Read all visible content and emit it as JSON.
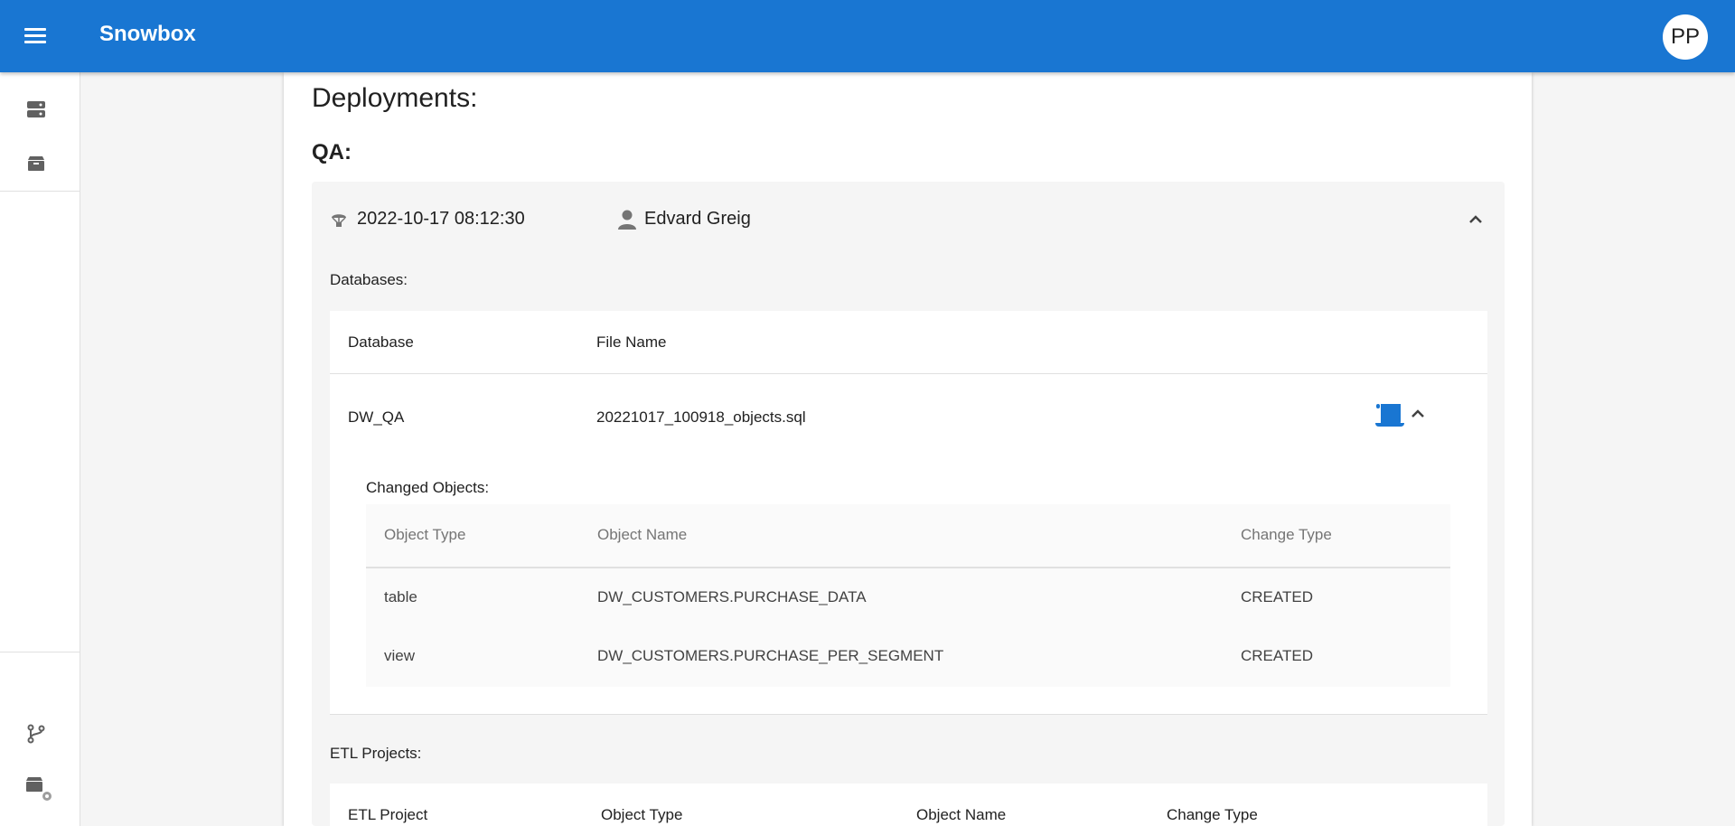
{
  "app": {
    "title": "Snowbox",
    "avatar_initials": "PP",
    "brand_color": "#1976d2"
  },
  "sidebar": {
    "top_items": [
      {
        "icon": "storage-icon"
      },
      {
        "icon": "package-icon"
      }
    ],
    "bottom_items": [
      {
        "icon": "git-branch-icon"
      },
      {
        "icon": "package-settings-icon"
      }
    ]
  },
  "page": {
    "heading": "Deployments:",
    "environment": "QA:"
  },
  "deployment": {
    "date": "2022-10-17 08:12:30",
    "user": "Edvard Greig",
    "databases_label": "Databases:",
    "databases_table": {
      "headers": [
        "Database",
        "File Name"
      ],
      "rows": [
        {
          "database": "DW_QA",
          "file_name": "20221017_100918_objects.sql"
        }
      ]
    },
    "changed_objects_label": "Changed Objects:",
    "changed_objects_table": {
      "headers": [
        "Object Type",
        "Object Name",
        "Change Type"
      ],
      "rows": [
        {
          "type": "table",
          "name": "DW_CUSTOMERS.PURCHASE_DATA",
          "change": "CREATED"
        },
        {
          "type": "view",
          "name": "DW_CUSTOMERS.PURCHASE_PER_SEGMENT",
          "change": "CREATED"
        }
      ]
    },
    "etl_label": "ETL Projects:",
    "etl_table": {
      "headers": [
        "ETL Project",
        "Object Type",
        "Object Name",
        "Change Type"
      ]
    }
  }
}
